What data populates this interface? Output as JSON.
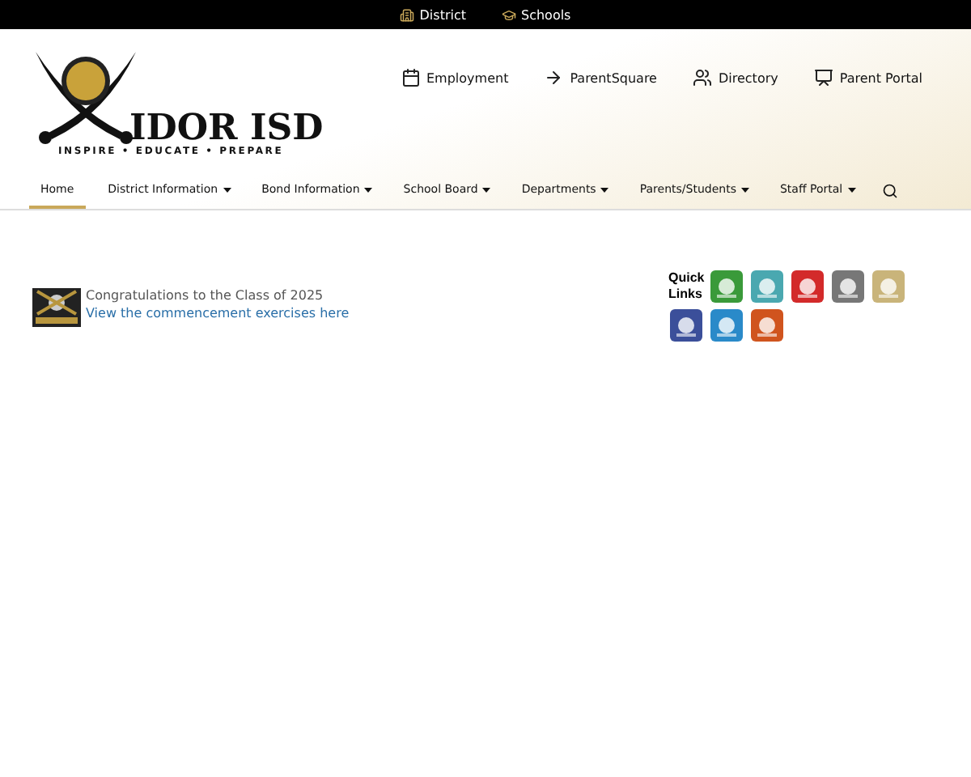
{
  "top_bar": [
    {
      "label": "District",
      "kind": "building"
    },
    {
      "label": "Schools",
      "kind": "cap"
    }
  ],
  "logo": {
    "name": "IDOR ISD",
    "motto": "INSPIRE • EDUCATE • PREPARE"
  },
  "utility_links": [
    {
      "label": "Employment",
      "kind": "calendar"
    },
    {
      "label": "ParentSquare",
      "kind": "arrow"
    },
    {
      "label": "Directory",
      "kind": "people"
    },
    {
      "label": "Parent Portal",
      "kind": "presentation"
    }
  ],
  "nav": [
    {
      "label": "Home",
      "selected": true,
      "dropdown": false
    },
    {
      "label": "District Information",
      "selected": false,
      "dropdown": true
    },
    {
      "label": "Bond Information",
      "selected": false,
      "dropdown": true
    },
    {
      "label": "School Board",
      "selected": false,
      "dropdown": true
    },
    {
      "label": "Departments",
      "selected": false,
      "dropdown": true
    },
    {
      "label": "Parents/Students",
      "selected": false,
      "dropdown": true
    },
    {
      "label": "Staff Portal",
      "selected": false,
      "dropdown": true
    }
  ],
  "announcement": {
    "title": "Congratulations to the Class of 2025",
    "link": "View the commencement exercises here"
  },
  "quick_links": {
    "title": "Quick Links"
  }
}
